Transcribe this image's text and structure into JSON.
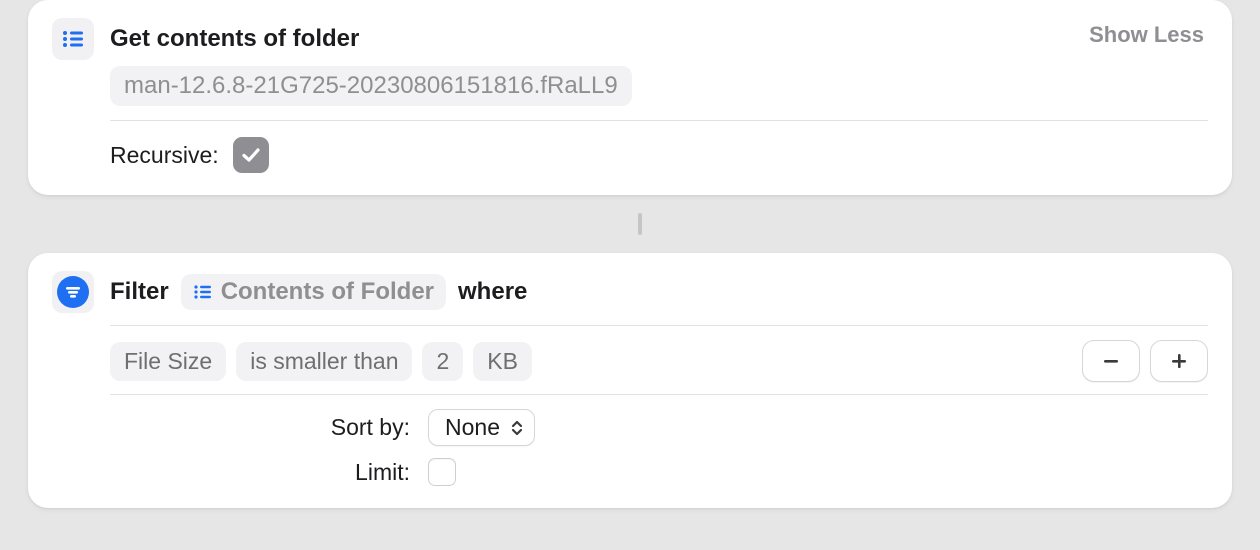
{
  "action1": {
    "title": "Get contents of folder",
    "show_less": "Show Less",
    "folder_token": "man-12.6.8-21G725-20230806151816.fRaLL9",
    "recursive_label": "Recursive:",
    "recursive_checked": true
  },
  "action2": {
    "title_prefix": "Filter",
    "variable_label": "Contents of Folder",
    "title_suffix": "where",
    "condition": {
      "attribute": "File Size",
      "operator": "is smaller than",
      "value": "2",
      "unit": "KB"
    },
    "sort_label": "Sort by:",
    "sort_value": "None",
    "limit_label": "Limit:",
    "limit_checked": false
  }
}
